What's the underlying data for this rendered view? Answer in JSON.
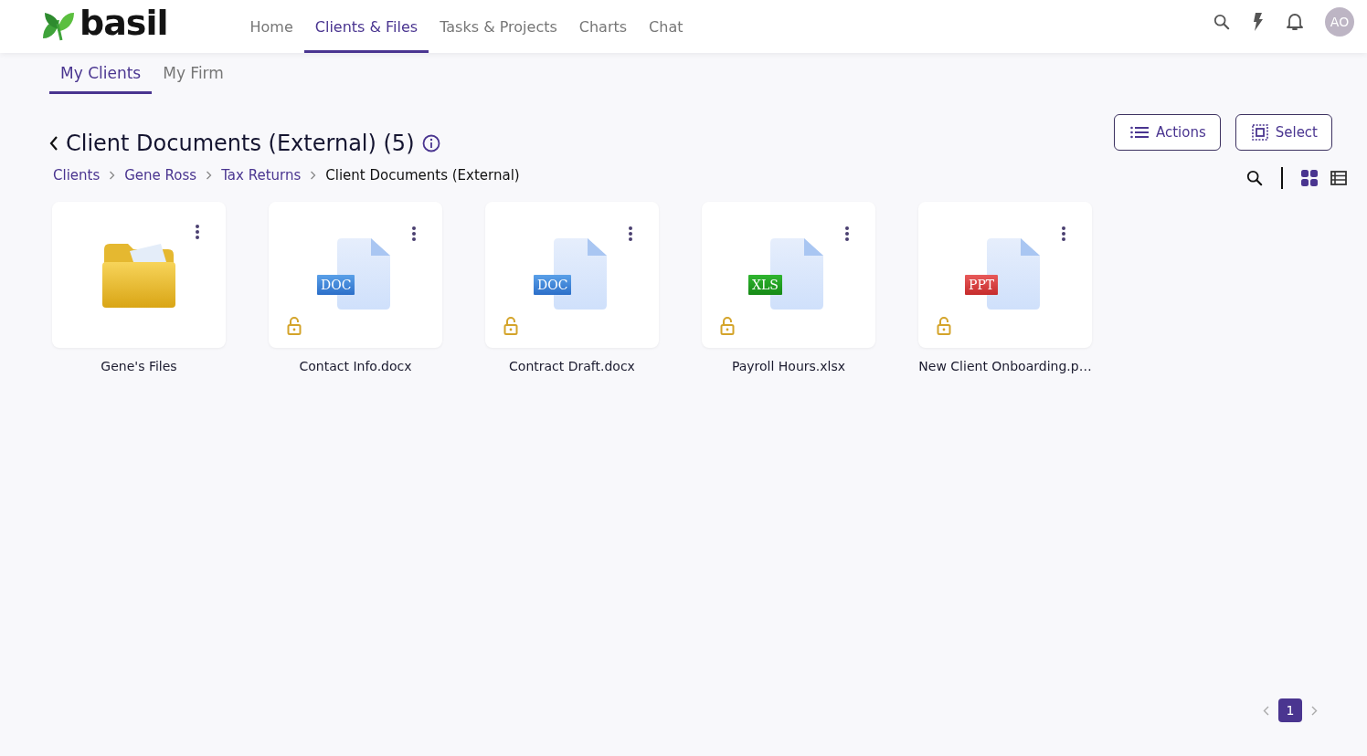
{
  "logo": {
    "text": "basil"
  },
  "nav": [
    {
      "label": "Home",
      "selected": false
    },
    {
      "label": "Clients & Files",
      "selected": true
    },
    {
      "label": "Tasks & Projects",
      "selected": false
    },
    {
      "label": "Charts",
      "selected": false
    },
    {
      "label": "Chat",
      "selected": false
    }
  ],
  "avatar": {
    "initials": "AO"
  },
  "sub_tabs": [
    {
      "label": "My Clients",
      "selected": true
    },
    {
      "label": "My Firm",
      "selected": false
    }
  ],
  "page": {
    "title": "Client Documents (External)",
    "count": "(5)"
  },
  "buttons": [
    {
      "kind": "actions",
      "label": "Actions"
    },
    {
      "kind": "select",
      "label": "Select"
    }
  ],
  "breadcrumb": [
    {
      "label": "Clients",
      "current": false
    },
    {
      "label": "Gene Ross",
      "current": false
    },
    {
      "label": "Tax Returns",
      "current": false
    },
    {
      "label": "Client Documents (External)",
      "current": true
    }
  ],
  "view_toggle": [
    {
      "kind": "grid",
      "selected": true
    },
    {
      "kind": "list",
      "selected": false
    }
  ],
  "items": [
    {
      "kind": "folder",
      "name": "Gene's Files"
    },
    {
      "kind": "doc",
      "badge": "DOC",
      "name": "Contact Info.docx",
      "locked": false
    },
    {
      "kind": "doc",
      "badge": "DOC",
      "name": "Contract Draft.docx",
      "locked": false
    },
    {
      "kind": "xls",
      "badge": "XLS",
      "name": "Payroll Hours.xlsx",
      "locked": false
    },
    {
      "kind": "ppt",
      "badge": "PPT",
      "name": "New Client Onboarding.p…",
      "locked": false
    }
  ],
  "pagination": [
    {
      "label": "1",
      "selected": true
    }
  ]
}
